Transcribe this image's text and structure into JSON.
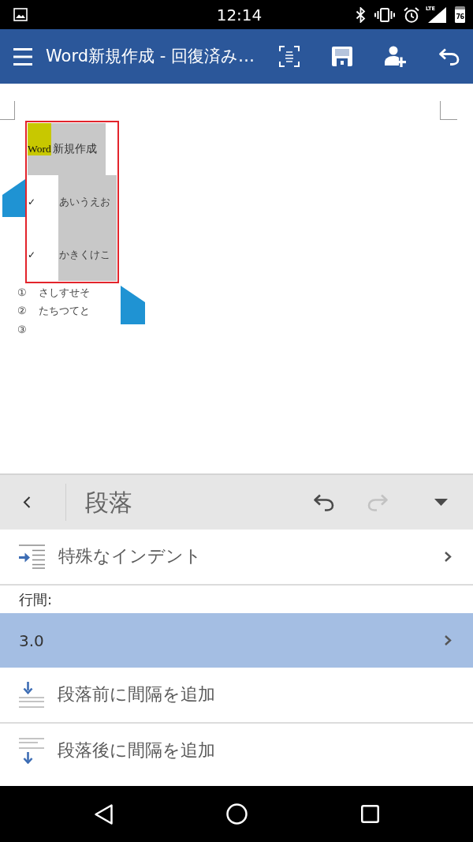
{
  "status_bar": {
    "time": "12:14",
    "network": "LTE",
    "battery": "76"
  },
  "app_bar": {
    "title": "Word新規作成 - 回復済み…"
  },
  "document": {
    "table": {
      "rows": [
        {
          "kind": "title",
          "segments": [
            {
              "text": "Word",
              "highlighted": true
            },
            {
              "text": "新規作成",
              "highlighted": false
            }
          ]
        },
        {
          "kind": "bullet",
          "bullet": "✓",
          "text": "あいうえお"
        },
        {
          "kind": "bullet",
          "bullet": "✓",
          "text": "かきくけこ"
        }
      ]
    },
    "numbered_list": [
      {
        "marker": "①",
        "text": "さしすせそ"
      },
      {
        "marker": "②",
        "text": "たちつてと"
      },
      {
        "marker": "③"
      }
    ]
  },
  "panel": {
    "header": {
      "title": "段落",
      "actions": [
        {
          "kind": "undo",
          "disabled": false
        },
        {
          "kind": "redo",
          "disabled": true
        },
        {
          "kind": "collapse",
          "disabled": false
        }
      ]
    },
    "rows": [
      {
        "kind": "indent",
        "label": "特殊なインデント",
        "selected": false
      },
      {
        "kind": "heading",
        "label": "行間:"
      },
      {
        "kind": "value",
        "label": "3.0",
        "selected": true
      },
      {
        "kind": "space-before",
        "label": "段落前に間隔を追加",
        "selected": false
      },
      {
        "kind": "space-after",
        "label": "段落後に間隔を追加",
        "selected": false
      }
    ]
  }
}
